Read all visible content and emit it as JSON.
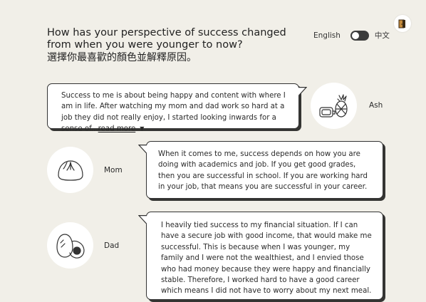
{
  "header": {
    "question_en": "How has your perspective of success changed from when you were younger to now?",
    "question_zh": "選擇你最喜歡的顏色並解釋原因。",
    "logo_icon": "door-logo-icon"
  },
  "language_toggle": {
    "left_label": "English",
    "right_label": "中文",
    "selected": "English"
  },
  "responses": [
    {
      "name": "Ash",
      "avatar_icon": "pineapple-and-battery-icon",
      "text": "Success to me is about being happy and content with where I am in life. After watching my mom and dad work so hard at a job they did not really enjoy, I started looking inwards for a sense of...",
      "read_more_label": "read more",
      "truncated": true
    },
    {
      "name": "Mom",
      "avatar_icon": "steamed-bun-icon",
      "text": "When it comes to me, success depends on how you are doing with academics and job. If you get good grades, then you are successful in school. If you are working hard in your job, that means you are successful in your career."
    },
    {
      "name": "Dad",
      "avatar_icon": "egg-icon",
      "text": "I heavily tied success to my financial situation. If I can have a secure job with good income, that would make me successful. This is because when I was younger, my family and I were not the wealthiest, and I envied those who had money because they were happy and financially stable. Therefore, I worked hard to have a good career which means I did not have to worry about my next meal."
    }
  ],
  "colors": {
    "background": "#f1efe8",
    "card": "#ffffff",
    "ink": "#2a2a2a",
    "toggle": "#3b3b3b"
  }
}
